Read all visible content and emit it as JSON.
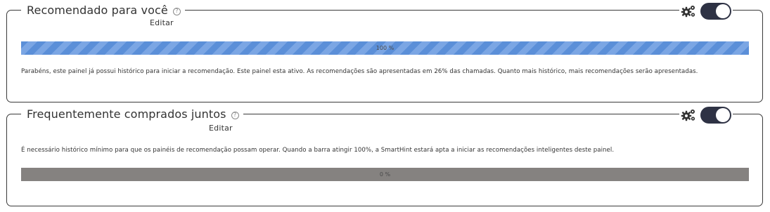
{
  "panels": [
    {
      "title": "Recomendado para você",
      "help_glyph": "?",
      "edit_label": "Editar",
      "progress_percent": 100,
      "progress_label": "100 %",
      "description": "Parabéns, este painel já possui histórico para iniciar a recomendação. Este painel esta ativo. As recomendações são apresentadas em 26% das chamadas. Quanto mais histórico, mais recomendações serão apresentadas.",
      "toggle_on": true,
      "bar_color": "#5b8fd8"
    },
    {
      "title": "Frequentemente comprados juntos",
      "help_glyph": "?",
      "edit_label": "Editar",
      "progress_percent": 0,
      "progress_label": "0 %",
      "description": "É necessário histórico mínimo para que os painéis de recomendação possam operar. Quando a barra atingir 100%, a SmartHint estará apta a iniciar as recomendações inteligentes deste painel.",
      "toggle_on": true,
      "bar_color": "#858280"
    }
  ],
  "icons": {
    "settings": "gears-icon",
    "help": "help-circle-icon",
    "toggle": "toggle-switch"
  },
  "colors": {
    "toggle_track": "#2e3244",
    "panel_border": "#3a3a3a"
  }
}
